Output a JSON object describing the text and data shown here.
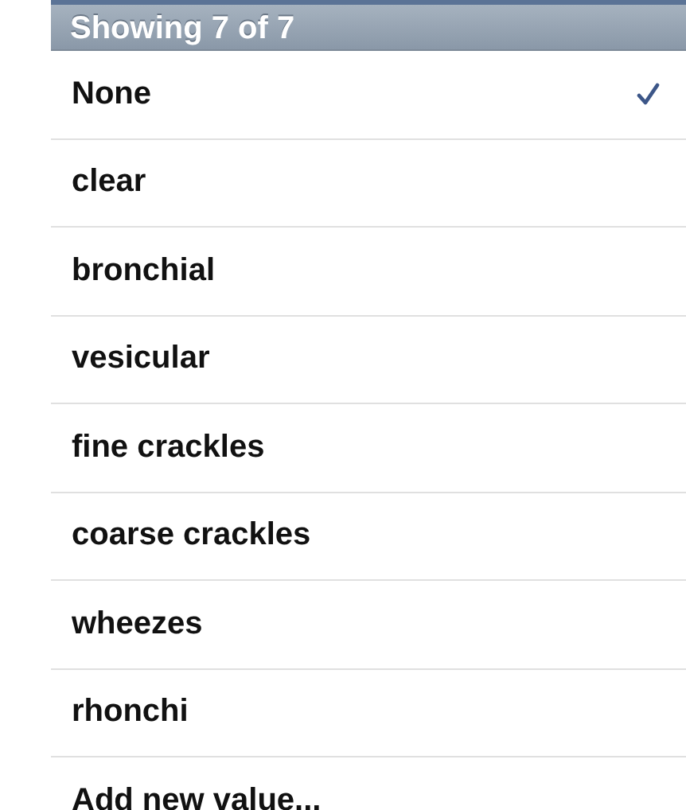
{
  "header": {
    "title": "Showing 7 of 7"
  },
  "items": [
    {
      "label": "None",
      "selected": true
    },
    {
      "label": "clear",
      "selected": false
    },
    {
      "label": "bronchial",
      "selected": false
    },
    {
      "label": "vesicular",
      "selected": false
    },
    {
      "label": "fine crackles",
      "selected": false
    },
    {
      "label": "coarse crackles",
      "selected": false
    },
    {
      "label": "wheezes",
      "selected": false
    },
    {
      "label": "rhonchi",
      "selected": false
    },
    {
      "label": "Add new value...",
      "selected": false
    }
  ]
}
